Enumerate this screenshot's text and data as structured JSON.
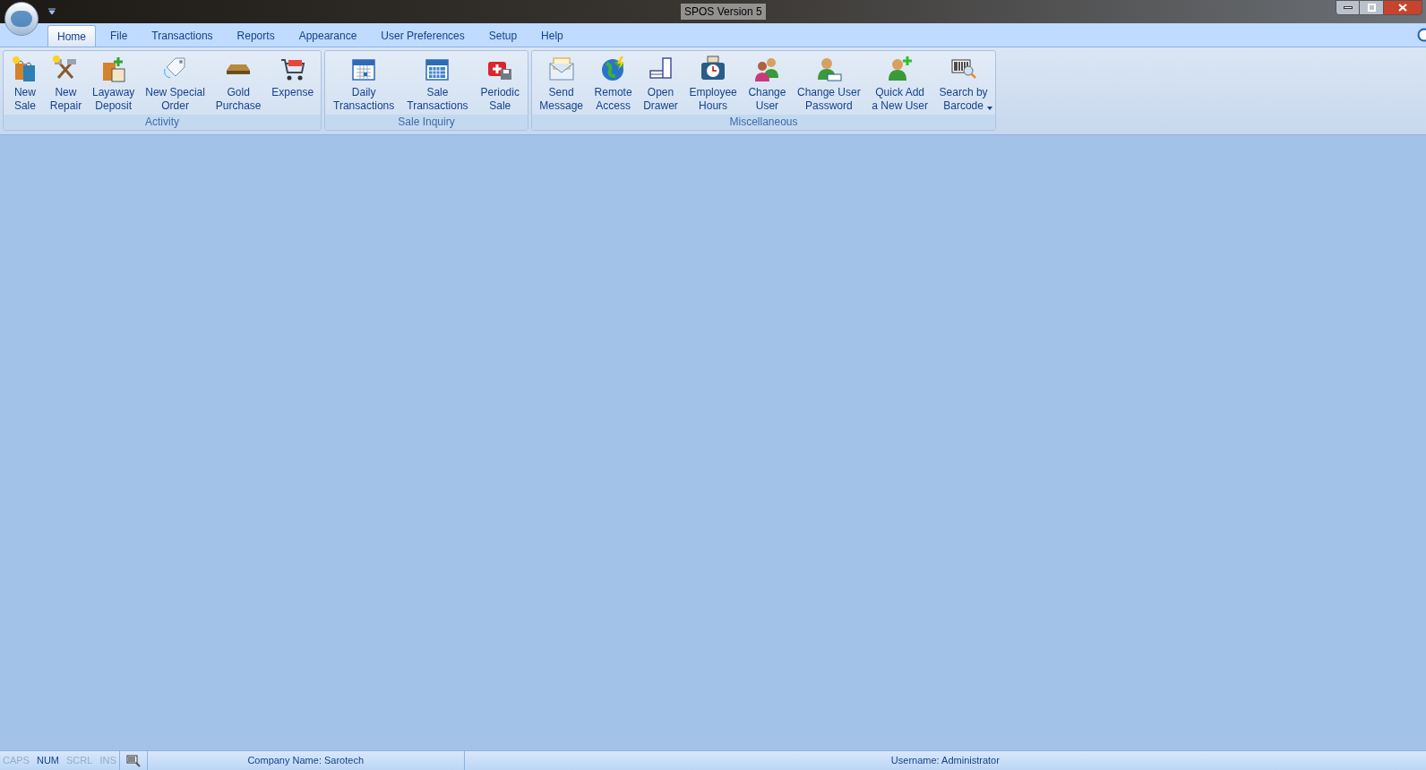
{
  "window": {
    "title": "SPOS Version 5"
  },
  "tabs": [
    {
      "label": "Home",
      "selected": true
    },
    {
      "label": "File",
      "selected": false
    },
    {
      "label": "Transactions",
      "selected": false
    },
    {
      "label": "Reports",
      "selected": false
    },
    {
      "label": "Appearance",
      "selected": false
    },
    {
      "label": "User Preferences",
      "selected": false
    },
    {
      "label": "Setup",
      "selected": false
    },
    {
      "label": "Help",
      "selected": false
    }
  ],
  "ribbon_groups": [
    {
      "title": "Activity",
      "buttons": [
        {
          "label": "New\nSale",
          "kind": "bags"
        },
        {
          "label": "New\nRepair",
          "kind": "tools"
        },
        {
          "label": "Layaway\nDeposit",
          "kind": "calendar-bag"
        },
        {
          "label": "New Special\nOrder",
          "kind": "tag"
        },
        {
          "label": "Gold\nPurchase",
          "kind": "bar"
        },
        {
          "label": "Expense",
          "kind": "cart"
        }
      ]
    },
    {
      "title": "Sale Inquiry",
      "buttons": [
        {
          "label": "Daily\nTransactions",
          "kind": "calendar"
        },
        {
          "label": "Sale\nTransactions",
          "kind": "calendar-full"
        },
        {
          "label": "Periodic\nSale",
          "kind": "kit"
        }
      ]
    },
    {
      "title": "Miscellaneous",
      "buttons": [
        {
          "label": "Send\nMessage",
          "kind": "envelope"
        },
        {
          "label": "Remote\nAccess",
          "kind": "globe"
        },
        {
          "label": "Open\nDrawer",
          "kind": "drawer"
        },
        {
          "label": "Employee\nHours",
          "kind": "clock"
        },
        {
          "label": "Change\nUser",
          "kind": "users"
        },
        {
          "label": "Change User\nPassword",
          "kind": "user-key"
        },
        {
          "label": "Quick Add\na New User",
          "kind": "user-add"
        },
        {
          "label": "Search by\nBarcode",
          "kind": "barcode",
          "dropdown": true
        }
      ]
    }
  ],
  "status_bar": {
    "indicators": [
      {
        "label": "CAPS",
        "on": false
      },
      {
        "label": "NUM",
        "on": true
      },
      {
        "label": "SCRL",
        "on": false
      },
      {
        "label": "INS",
        "on": false
      }
    ],
    "company": "Company Name: Sarotech",
    "username": "Username: Administrator"
  }
}
